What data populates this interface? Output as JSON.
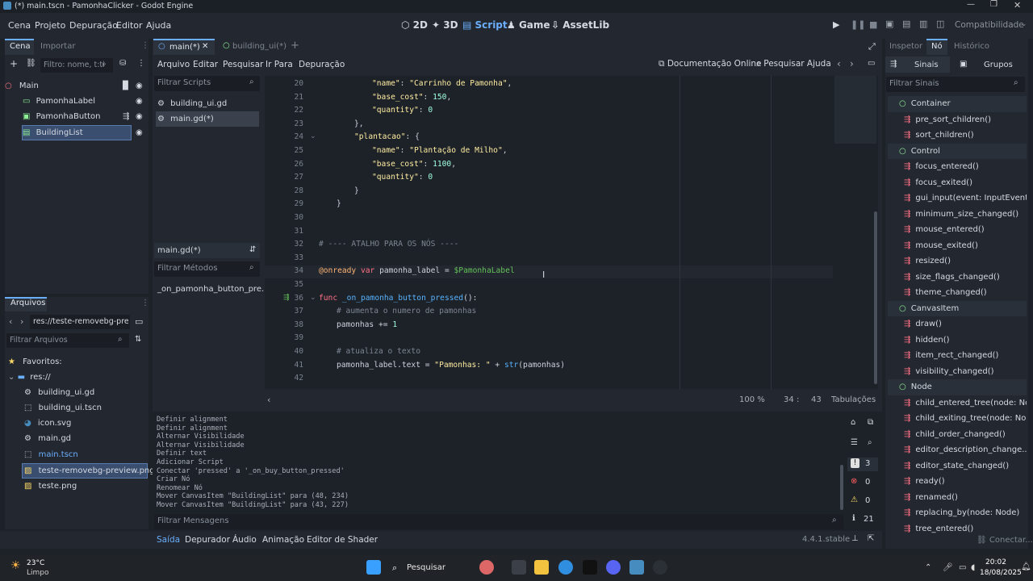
{
  "window": {
    "title": "(*) main.tscn - PamonhaClicker - Godot Engine"
  },
  "menu": [
    "Cena",
    "Projeto",
    "Depuração",
    "Editor",
    "Ajuda"
  ],
  "workspaces": [
    "2D",
    "3D",
    "Script",
    "Game",
    "AssetLib"
  ],
  "renderer": "Compatibilidade",
  "scene_dock": {
    "tabs": [
      "Cena",
      "Importar"
    ],
    "filter_placeholder": "Filtro: nome, t:ti",
    "nodes": [
      "Main",
      "PamonhaLabel",
      "PamonhaButton",
      "BuildingList"
    ]
  },
  "files_dock": {
    "title": "Arquivos",
    "path": "res://teste-removebg-prev",
    "filter_placeholder": "Filtrar Arquivos",
    "favorites": "Favoritos:",
    "root": "res://",
    "files": [
      "building_ui.gd",
      "building_ui.tscn",
      "icon.svg",
      "main.gd",
      "main.tscn",
      "teste-removebg-preview.png",
      "teste.png"
    ]
  },
  "editor_tabs": [
    "main(*)",
    "building_ui(*)"
  ],
  "script_menu": [
    "Arquivo",
    "Editar",
    "Pesquisar",
    "Ir Para",
    "Depuração"
  ],
  "script_links": [
    "Documentação Online",
    "Pesquisar Ajuda"
  ],
  "scripts_panel": {
    "filter_placeholder": "Filtrar Scripts",
    "scripts": [
      "building_ui.gd",
      "main.gd(*)"
    ],
    "current": "main.gd(*)",
    "methods_placeholder": "Filtrar Métodos",
    "methods": [
      "_on_pamonha_button_pre..."
    ]
  },
  "code": [
    {
      "n": "20",
      "t": "\"name\": \"Carrinho de Pamonha\","
    },
    {
      "n": "21",
      "t": "\"base_cost\": 150,"
    },
    {
      "n": "22",
      "t": "\"quantity\": 0"
    },
    {
      "n": "23",
      "t": "},"
    },
    {
      "n": "24",
      "t": "\"plantacao\": {"
    },
    {
      "n": "25",
      "t": "\"name\": \"Plantação de Milho\","
    },
    {
      "n": "26",
      "t": "\"base_cost\": 1100,"
    },
    {
      "n": "27",
      "t": "\"quantity\": 0"
    },
    {
      "n": "28",
      "t": "}"
    },
    {
      "n": "29",
      "t": "}"
    },
    {
      "n": "30",
      "t": ""
    },
    {
      "n": "31",
      "t": ""
    },
    {
      "n": "32",
      "t": "# ---- ATALHO PARA OS NÓS ----"
    },
    {
      "n": "33",
      "t": ""
    },
    {
      "n": "34",
      "t": "@onready var pamonha_label = $PamonhaLabel"
    },
    {
      "n": "35",
      "t": ""
    },
    {
      "n": "36",
      "t": "func _on_pamonha_button_pressed():"
    },
    {
      "n": "37",
      "t": "# aumenta o numero de pamonhas"
    },
    {
      "n": "38",
      "t": "pamonhas += 1"
    },
    {
      "n": "39",
      "t": ""
    },
    {
      "n": "40",
      "t": "# atualiza o texto"
    },
    {
      "n": "41",
      "t": "pamonha_label.text = \"Pamonhas: \" + str(pamonhas)"
    },
    {
      "n": "42",
      "t": ""
    }
  ],
  "status": {
    "zoom": "100 %",
    "line": "34",
    "col": "43",
    "indent": "Tabulações"
  },
  "output": {
    "lines": [
      "Definir alignment",
      "Definir alignment",
      "Alternar Visibilidade",
      "Alternar Visibilidade",
      "Definir text",
      "Adicionar Script",
      "Conectar 'pressed' a '_on_buy_button_pressed'",
      "Criar Nó",
      "Renomear Nó",
      "Mover CanvasItem \"BuildingList\" para (48, 234)",
      "Mover CanvasItem \"BuildingList\" para (43, 227)"
    ],
    "filter_placeholder": "Filtrar Mensagens",
    "counts": {
      "errors": "3",
      "warnings": "0",
      "info": "0",
      "messages": "21"
    }
  },
  "bottom_tabs": [
    "Saída",
    "Depurador",
    "Áudio",
    "Animação",
    "Editor de Shader"
  ],
  "version": "4.4.1.stable",
  "inspector": {
    "tabs": [
      "Inspetor",
      "Nó",
      "Histórico"
    ],
    "subtabs": [
      "Sinais",
      "Grupos"
    ],
    "filter_placeholder": "Filtrar Sinais",
    "signals": [
      {
        "h": true,
        "t": "Container"
      },
      {
        "h": false,
        "t": "pre_sort_children()"
      },
      {
        "h": false,
        "t": "sort_children()"
      },
      {
        "h": true,
        "t": "Control"
      },
      {
        "h": false,
        "t": "focus_entered()"
      },
      {
        "h": false,
        "t": "focus_exited()"
      },
      {
        "h": false,
        "t": "gui_input(event: InputEvent)"
      },
      {
        "h": false,
        "t": "minimum_size_changed()"
      },
      {
        "h": false,
        "t": "mouse_entered()"
      },
      {
        "h": false,
        "t": "mouse_exited()"
      },
      {
        "h": false,
        "t": "resized()"
      },
      {
        "h": false,
        "t": "size_flags_changed()"
      },
      {
        "h": false,
        "t": "theme_changed()"
      },
      {
        "h": true,
        "t": "CanvasItem"
      },
      {
        "h": false,
        "t": "draw()"
      },
      {
        "h": false,
        "t": "hidden()"
      },
      {
        "h": false,
        "t": "item_rect_changed()"
      },
      {
        "h": false,
        "t": "visibility_changed()"
      },
      {
        "h": true,
        "t": "Node"
      },
      {
        "h": false,
        "t": "child_entered_tree(node: No..."
      },
      {
        "h": false,
        "t": "child_exiting_tree(node: No..."
      },
      {
        "h": false,
        "t": "child_order_changed()"
      },
      {
        "h": false,
        "t": "editor_description_change..."
      },
      {
        "h": false,
        "t": "editor_state_changed()"
      },
      {
        "h": false,
        "t": "ready()"
      },
      {
        "h": false,
        "t": "renamed()"
      },
      {
        "h": false,
        "t": "replacing_by(node: Node)"
      },
      {
        "h": false,
        "t": "tree_entered()"
      }
    ],
    "connect": "Conectar..."
  },
  "taskbar": {
    "weather_temp": "23°C",
    "weather_desc": "Limpo",
    "search": "Pesquisar",
    "time": "20:02",
    "date": "18/08/2025"
  },
  "colors": {
    "accent": "#6aaefc",
    "bg": "#1d2229",
    "panel": "#232830"
  }
}
